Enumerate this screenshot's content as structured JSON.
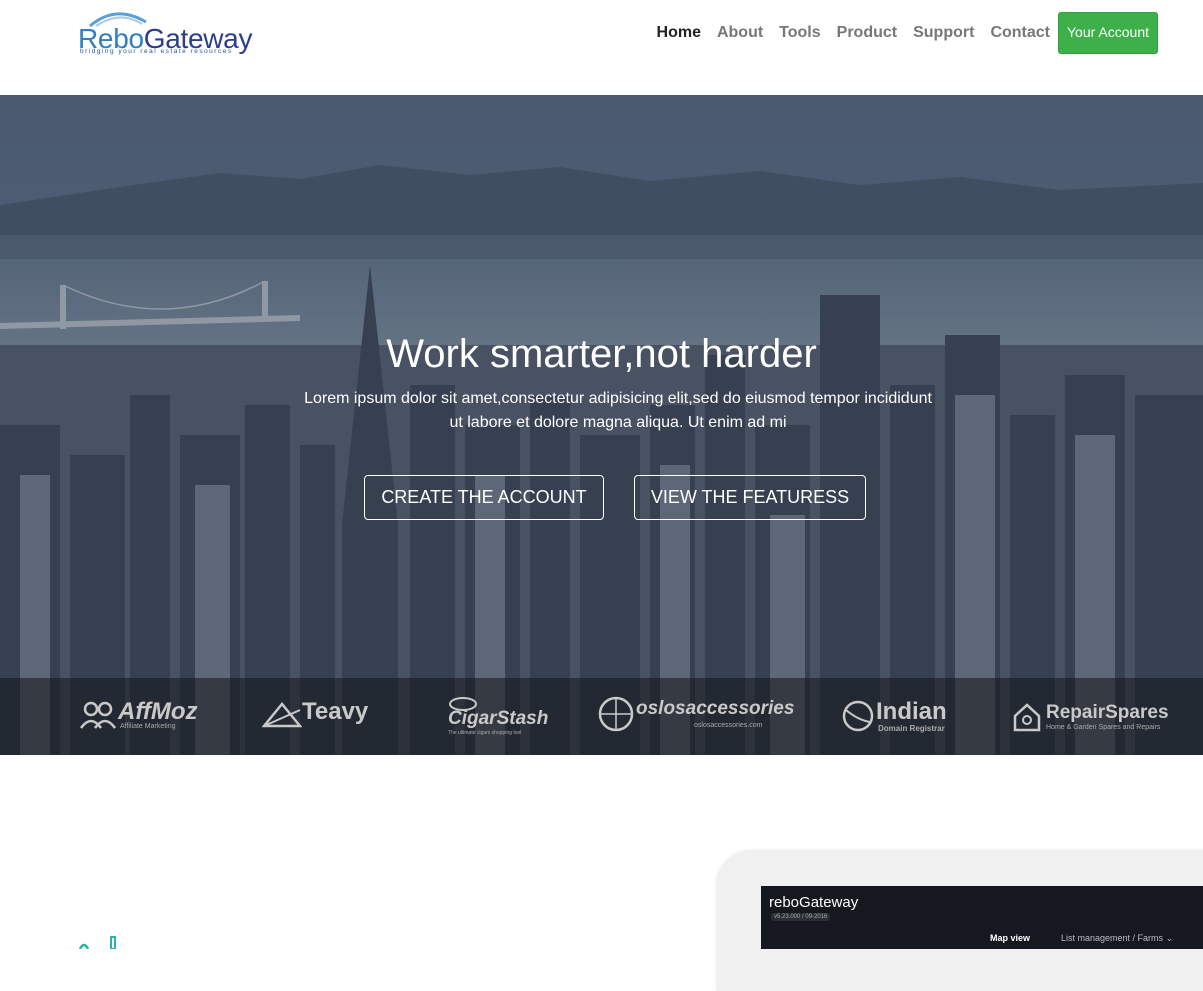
{
  "header": {
    "logo": {
      "text_a": "Rebo",
      "text_b": "Gateway",
      "tagline": "bridging your real estate resources"
    },
    "nav": [
      {
        "label": "Home",
        "active": true
      },
      {
        "label": "About"
      },
      {
        "label": "Tools"
      },
      {
        "label": "Product"
      },
      {
        "label": "Support"
      },
      {
        "label": "Contact"
      }
    ],
    "account_button": "Your Account"
  },
  "hero": {
    "title": "Work smarter,not harder",
    "text_line1": "Lorem ipsum dolor sit amet,consectetur adipisicing elit,sed do eiusmod tempor incididunt",
    "text_line2": "ut labore et dolore magna aliqua. Ut enim ad mi",
    "btn_create": "CREATE THE ACCOUNT",
    "btn_features": "VIEW THE FEATURESS"
  },
  "partners": [
    {
      "name": "AffMoz",
      "sub": "Affiliate Marketing",
      "icon": "people-icon"
    },
    {
      "name": "Teavy",
      "sub": "",
      "icon": "tent-icon"
    },
    {
      "name": "CigarStash",
      "sub": "The ultimate cigars shopping tool",
      "icon": "cigar-icon"
    },
    {
      "name": "oslosaccessories",
      "sub": "oslosaccessories.com",
      "icon": "globe-icon"
    },
    {
      "name": "Indian",
      "sub": "Domain Registrar",
      "icon": "globe-icon"
    },
    {
      "name": "RepairSpares",
      "sub": "Home & Garden Spares and Repairs",
      "icon": "house-icon"
    }
  ],
  "app_preview": {
    "title": "reboGateway",
    "version": "v5.23.000 / 09-2016",
    "tab_active": "Map view",
    "tab_other": "List management / Farms"
  },
  "colors": {
    "accent_green": "#3eb049",
    "logo_light": "#2f7fc1",
    "logo_dark": "#2b3e8c"
  }
}
